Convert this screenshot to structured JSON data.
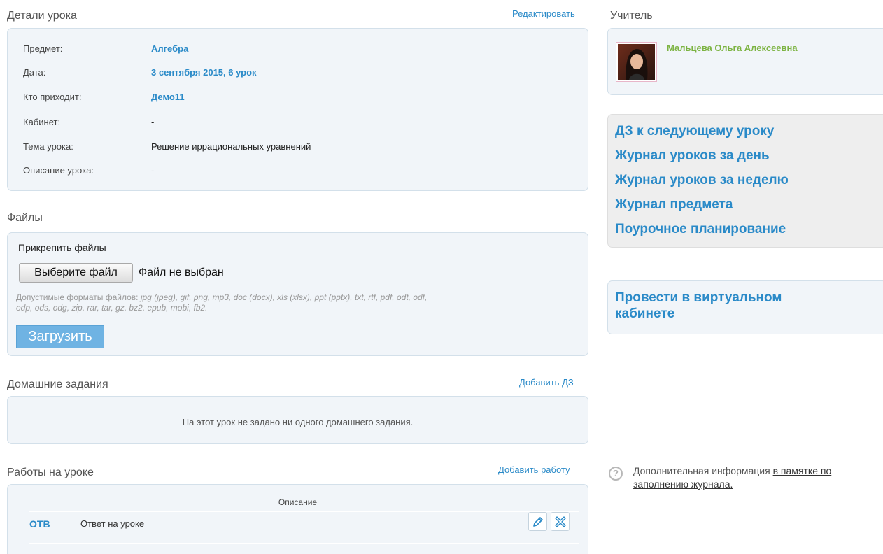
{
  "details": {
    "title": "Детали урока",
    "edit_link": "Редактировать",
    "rows": [
      {
        "label": "Предмет:",
        "value": "Алгебра",
        "kind": "link"
      },
      {
        "label": "Дата:",
        "value": "3 сентября 2015, 6 урок",
        "kind": "link"
      },
      {
        "label": "Кто приходит:",
        "value": "Демо11",
        "kind": "link"
      },
      {
        "label": "Кабинет:",
        "value": "-",
        "kind": "plain"
      },
      {
        "label": "Тема урока:",
        "value": "Решение иррациональных уравнений",
        "kind": "plain"
      },
      {
        "label": "Описание урока:",
        "value": "-",
        "kind": "plain"
      }
    ]
  },
  "files": {
    "title": "Файлы",
    "attach_label": "Прикрепить файлы",
    "choose_button": "Выберите файл",
    "no_file": "Файл не выбран",
    "formats_prefix": "Допустимые форматы файлов:",
    "formats_line1": "jpg (jpeg), gif, png, mp3, doc (docx), xls (xlsx), ppt (pptx), txt, rtf, pdf, odt, odf,",
    "formats_line2": "odp, ods, odg, zip, rar, tar, gz, bz2, epub, mobi, fb2.",
    "upload_button": "Загрузить"
  },
  "homework": {
    "title": "Домашние задания",
    "add_link": "Добавить ДЗ",
    "empty_text": "На этот урок не задано ни одного домашнего задания."
  },
  "works": {
    "title": "Работы на уроке",
    "add_link": "Добавить работу",
    "column_header": "Описание",
    "rows": [
      {
        "code": "ОТВ",
        "description": "Ответ на уроке",
        "edit_icon": "pencil-icon",
        "delete_icon": "delete-icon"
      }
    ]
  },
  "teacher": {
    "title": "Учитель",
    "name": "Мальцева Ольга Алексеевна"
  },
  "quick_links": [
    "ДЗ к следующему уроку",
    "Журнал уроков за день",
    "Журнал уроков за неделю",
    "Журнал предмета",
    "Поурочное планирование"
  ],
  "virtual": {
    "line1": "Провести в виртуальном",
    "line2": "кабинете"
  },
  "help": {
    "text": "Дополнительная информация",
    "link_line1": "в памятке по",
    "link_line2": "заполнению журнала.",
    "icon": "question-icon"
  },
  "colors": {
    "link": "#2a8ac8",
    "teacher_name": "#7cb342",
    "card_bg": "#f1f5f9",
    "card_border": "#d3e0ea",
    "upload_button": "#6fb3e3"
  }
}
